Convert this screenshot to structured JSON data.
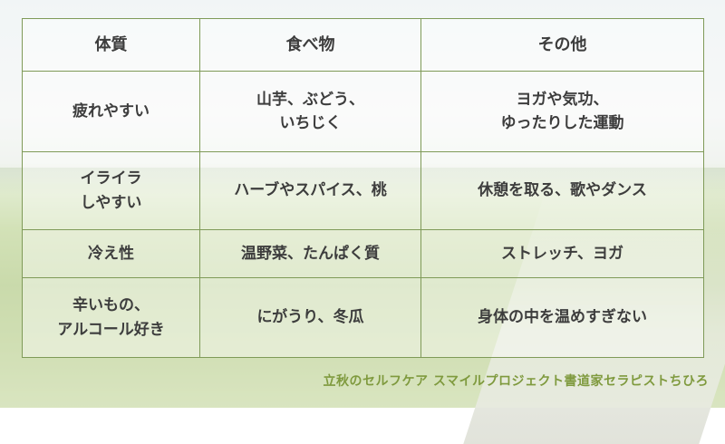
{
  "table": {
    "headers": [
      "体質",
      "食べ物",
      "その他"
    ],
    "rows": [
      {
        "constitution": [
          "疲れやすい"
        ],
        "food": [
          "山芋、ぶどう、",
          "いちじく"
        ],
        "other": [
          "ヨガや気功、",
          "ゆったりした運動"
        ]
      },
      {
        "constitution": [
          "イライラ",
          "しやすい"
        ],
        "food": [
          "ハーブやスパイス、桃"
        ],
        "other": [
          "休憩を取る、歌やダンス"
        ]
      },
      {
        "constitution": [
          "冷え性"
        ],
        "food": [
          "温野菜、たんぱく質"
        ],
        "other": [
          "ストレッチ、ヨガ"
        ]
      },
      {
        "constitution": [
          "辛いもの、",
          "アルコール好き"
        ],
        "food": [
          "にがうり、冬瓜"
        ],
        "other": [
          "身体の中を温めすぎない"
        ]
      }
    ]
  },
  "footer": "立秋のセルフケア スマイルプロジェクト書道家セラピストちひろ",
  "colors": {
    "border": "#7f9a58",
    "text": "#3d3d3d",
    "footer": "#7f9a3e"
  }
}
